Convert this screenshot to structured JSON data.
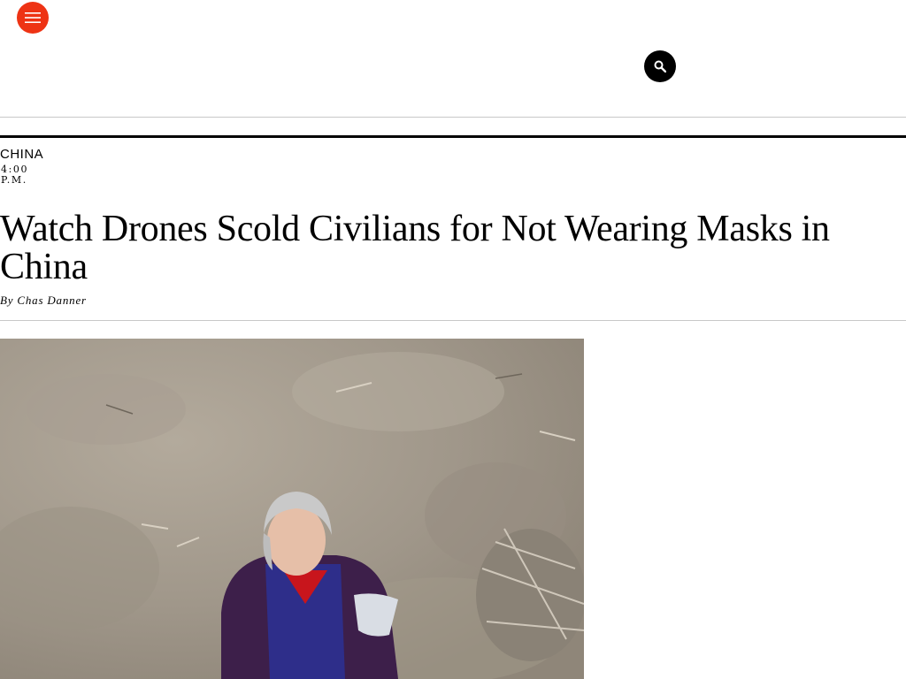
{
  "header": {
    "menu_icon": "hamburger-menu-icon",
    "search_icon": "search-icon",
    "accent_color": "#ee3314"
  },
  "article": {
    "rubric": "CHINA",
    "time": "4:00 P.M.",
    "headline": "Watch Drones Scold Civilians for Not Wearing Masks in China",
    "byline_prefix": "By",
    "author": "Chas Danner"
  }
}
